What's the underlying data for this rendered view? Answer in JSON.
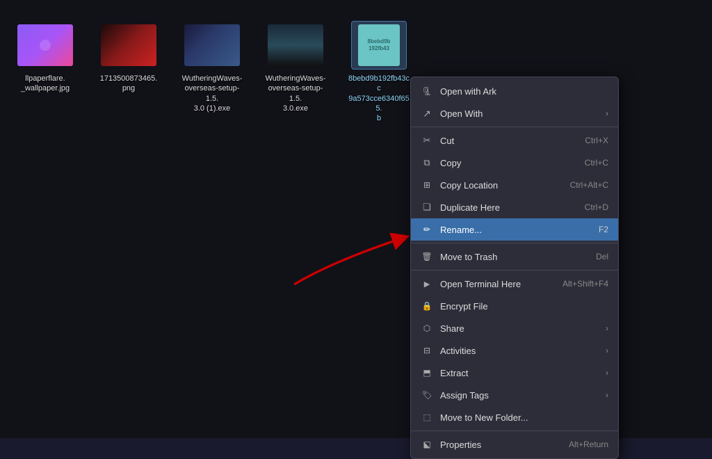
{
  "desktop": {
    "background": "#111118"
  },
  "files": [
    {
      "id": "file1",
      "label": "llpaperflare.\n_wallpaper.jpg",
      "type": "image-purple",
      "selected": false
    },
    {
      "id": "file2",
      "label": "1713500873465.\npng",
      "type": "image-red",
      "selected": false
    },
    {
      "id": "file3",
      "label": "WutheringWaves-overseas-setup-1.5.3.0 (1).exe",
      "type": "image-anime1",
      "selected": false
    },
    {
      "id": "file4",
      "label": "WutheringWaves-overseas-setup-1.5.3.0.exe",
      "type": "image-anime2",
      "selected": false
    },
    {
      "id": "file5",
      "label": "8bebd9b192fb43cc9a573cce6340f655. b",
      "type": "file-teal",
      "selected": true
    }
  ],
  "contextMenu": {
    "items": [
      {
        "id": "open-ark",
        "label": "Open with Ark",
        "icon": "ark",
        "shortcut": "",
        "hasArrow": false,
        "dividerAfter": false
      },
      {
        "id": "open-with",
        "label": "Open With",
        "icon": "openwith",
        "shortcut": "",
        "hasArrow": true,
        "dividerAfter": true
      },
      {
        "id": "cut",
        "label": "Cut",
        "icon": "cut",
        "shortcut": "Ctrl+X",
        "hasArrow": false,
        "dividerAfter": false
      },
      {
        "id": "copy",
        "label": "Copy",
        "icon": "copy",
        "shortcut": "Ctrl+C",
        "hasArrow": false,
        "dividerAfter": false
      },
      {
        "id": "copy-location",
        "label": "Copy Location",
        "icon": "copyloc",
        "shortcut": "Ctrl+Alt+C",
        "hasArrow": false,
        "dividerAfter": false
      },
      {
        "id": "duplicate-here",
        "label": "Duplicate Here",
        "icon": "duplicate",
        "shortcut": "Ctrl+D",
        "hasArrow": false,
        "dividerAfter": false
      },
      {
        "id": "rename",
        "label": "Rename...",
        "icon": "rename",
        "shortcut": "F2",
        "hasArrow": false,
        "highlighted": true,
        "dividerAfter": false
      },
      {
        "id": "move-trash",
        "label": "Move to Trash",
        "icon": "trash",
        "shortcut": "Del",
        "hasArrow": false,
        "dividerAfter": true
      },
      {
        "id": "open-terminal",
        "label": "Open Terminal Here",
        "icon": "terminal",
        "shortcut": "Alt+Shift+F4",
        "hasArrow": false,
        "dividerAfter": false
      },
      {
        "id": "encrypt-file",
        "label": "Encrypt File",
        "icon": "encrypt",
        "shortcut": "",
        "hasArrow": false,
        "dividerAfter": false
      },
      {
        "id": "share",
        "label": "Share",
        "icon": "share",
        "shortcut": "",
        "hasArrow": true,
        "dividerAfter": false
      },
      {
        "id": "activities",
        "label": "Activities",
        "icon": "activities",
        "shortcut": "",
        "hasArrow": true,
        "dividerAfter": false
      },
      {
        "id": "extract",
        "label": "Extract",
        "icon": "extract",
        "shortcut": "",
        "hasArrow": true,
        "dividerAfter": false
      },
      {
        "id": "assign-tags",
        "label": "Assign Tags",
        "icon": "tags",
        "shortcut": "",
        "hasArrow": true,
        "dividerAfter": false
      },
      {
        "id": "move-new-folder",
        "label": "Move to New Folder...",
        "icon": "movefolder",
        "shortcut": "",
        "hasArrow": false,
        "dividerAfter": true
      },
      {
        "id": "properties",
        "label": "Properties",
        "icon": "properties",
        "shortcut": "Alt+Return",
        "hasArrow": false,
        "dividerAfter": false
      }
    ]
  }
}
